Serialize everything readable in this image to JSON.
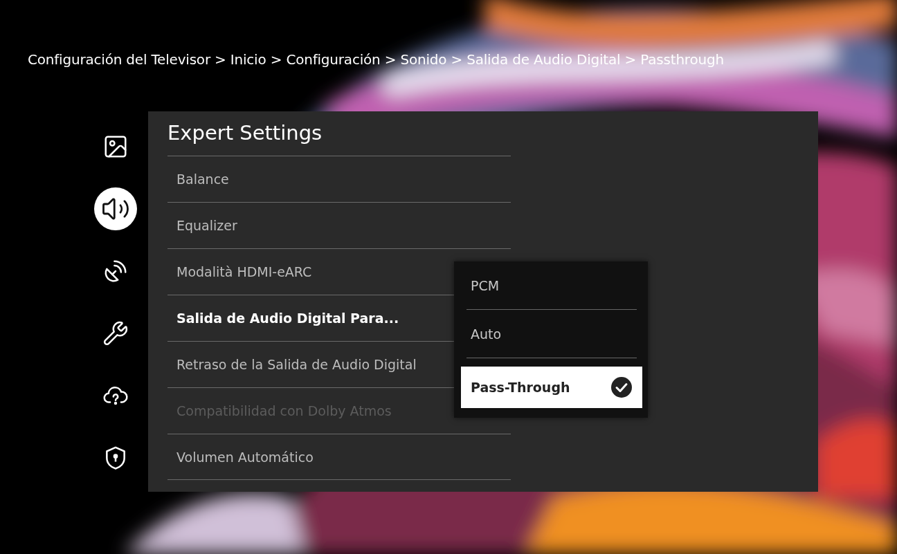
{
  "breadcrumb": "Configuración del Televisor > Inicio > Configuración > Sonido > Salida de Audio Digital > Passthrough",
  "sidebar": {
    "items": [
      {
        "kind": "picture",
        "selected": false
      },
      {
        "kind": "sound",
        "selected": true
      },
      {
        "kind": "broadcast",
        "selected": false
      },
      {
        "kind": "tools",
        "selected": false
      },
      {
        "kind": "support",
        "selected": false
      },
      {
        "kind": "privacy",
        "selected": false
      }
    ]
  },
  "panel": {
    "title": "Expert Settings",
    "items": [
      {
        "label": "Balance",
        "focused": false,
        "disabled": false
      },
      {
        "label": "Equalizer",
        "focused": false,
        "disabled": false
      },
      {
        "label": "Modalità HDMI-eARC",
        "focused": false,
        "disabled": false
      },
      {
        "label": "Salida de Audio Digital Para...",
        "focused": true,
        "disabled": false
      },
      {
        "label": "Retraso de la Salida de Audio Digital",
        "focused": false,
        "disabled": false
      },
      {
        "label": "Compatibilidad con Dolby Atmos",
        "focused": false,
        "disabled": true
      },
      {
        "label": "Volumen Automático",
        "focused": false,
        "disabled": false
      }
    ]
  },
  "popup": {
    "options": [
      {
        "label": "PCM",
        "selected": false
      },
      {
        "label": "Auto",
        "selected": false
      },
      {
        "label": "Pass-Through",
        "selected": true
      }
    ]
  }
}
